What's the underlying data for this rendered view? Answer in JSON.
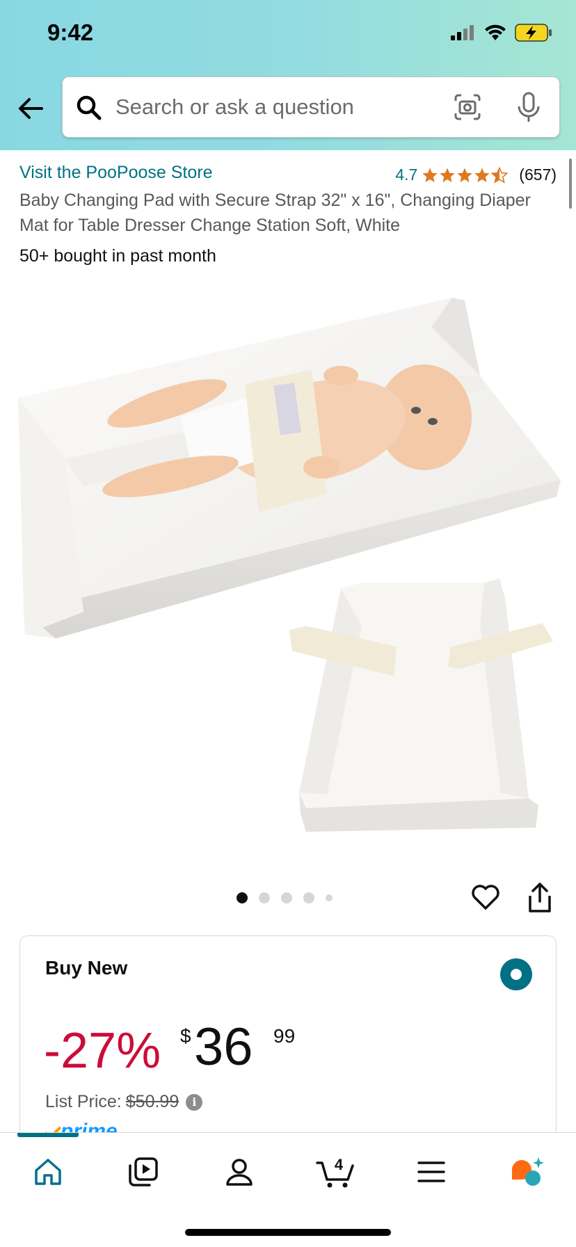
{
  "status_bar": {
    "time": "9:42"
  },
  "search": {
    "placeholder": "Search or ask a question"
  },
  "product": {
    "store_link": "Visit the PooPoose Store",
    "rating_value": "4.7",
    "rating_count": "(657)",
    "title": "Baby Changing Pad with Secure Strap 32\" x 16\", Changing Diaper Mat for Table Dresser Change Station Soft, White",
    "bought_text": "50+ bought in past month",
    "image_count": 5,
    "active_image": 1
  },
  "buy_box": {
    "label": "Buy New",
    "discount": "-27%",
    "currency_symbol": "$",
    "price_whole": "36",
    "price_fraction": "99",
    "list_price_label": "List Price:",
    "list_price": "$50.99",
    "prime_label": "prime"
  },
  "bottom_nav": {
    "cart_count": "4",
    "items": [
      "home-icon",
      "video-icon",
      "account-icon",
      "cart-icon",
      "menu-icon",
      "rufus-icon"
    ]
  },
  "colors": {
    "link": "#007185",
    "star": "#de7921",
    "discount": "#cc0c39",
    "prime": "#1399ff"
  }
}
